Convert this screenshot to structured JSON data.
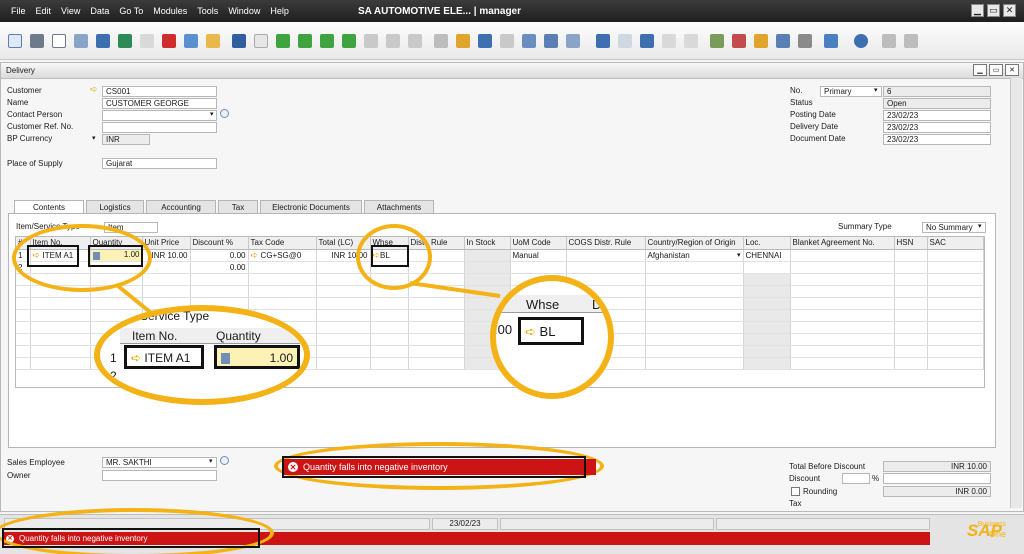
{
  "menu": [
    "File",
    "Edit",
    "View",
    "Data",
    "Go To",
    "Modules",
    "Tools",
    "Window",
    "Help"
  ],
  "app_title": "SA AUTOMOTIVE ELE... | manager",
  "window_buttons": [
    "▁",
    "▭",
    "✕"
  ],
  "doc": {
    "title": "Delivery",
    "header_left": {
      "customer_label": "Customer",
      "customer_value": "CS001",
      "name_label": "Name",
      "name_value": "CUSTOMER GEORGE",
      "contact_label": "Contact Person",
      "contact_value": "",
      "custref_label": "Customer Ref. No.",
      "custref_value": "",
      "currency_label": "BP Currency",
      "currency_value": "INR",
      "place_label": "Place of Supply",
      "place_value": "Gujarat"
    },
    "header_right": {
      "no_label": "No.",
      "series": "Primary",
      "no_value": "6",
      "status_label": "Status",
      "status_value": "Open",
      "posting_label": "Posting Date",
      "posting_value": "23/02/23",
      "delivery_label": "Delivery Date",
      "delivery_value": "23/02/23",
      "document_label": "Document Date",
      "document_value": "23/02/23"
    },
    "tabs": [
      "Contents",
      "Logistics",
      "Accounting",
      "Tax",
      "Electronic Documents",
      "Attachments"
    ],
    "item_type_label": "Item/Service Type",
    "item_type_value": "Item",
    "summary_label": "Summary Type",
    "summary_value": "No Summary",
    "columns": [
      "#",
      "Item No.",
      "Quantity",
      "Unit Price",
      "Discount %",
      "Tax Code",
      "Total (LC)",
      "Whse",
      "Distr. Rule",
      "In Stock",
      "UoM Code",
      "COGS Distr. Rule",
      "Country/Region of Origin",
      "Loc.",
      "Blanket Agreement No.",
      "HSN",
      "SAC"
    ],
    "rows": [
      {
        "n": "1",
        "item": "ITEM A1",
        "qty": "1.00",
        "price": "INR 10.00",
        "disc": "0.00",
        "tax": "CG+SG@0",
        "total": "INR 10.00",
        "whse": "BL",
        "distr": "",
        "stock": "",
        "uom": "Manual",
        "cogs": "",
        "country": "Afghanistan",
        "loc": "CHENNAI",
        "blanket": "",
        "hsn": "",
        "sac": ""
      },
      {
        "n": "2",
        "item": "",
        "qty": "",
        "price": "",
        "disc": "0.00",
        "tax": "",
        "total": "",
        "whse": "",
        "distr": "",
        "stock": "",
        "uom": "",
        "cogs": "",
        "country": "",
        "loc": "",
        "blanket": "",
        "hsn": "",
        "sac": ""
      }
    ],
    "zoom1": {
      "summary_fragment": "Service Type",
      "col_item": "Item No.",
      "col_qty": "Quantity",
      "row1_n": "1",
      "row1_item": "ITEM A1",
      "row1_qty": "1.00",
      "row2_n": "2",
      "edge": "1"
    },
    "zoom2": {
      "col_whse": "Whse",
      "col_next": "D",
      "qty_tail": ".00",
      "whse_value": "BL"
    },
    "footer_left": {
      "sales_emp_label": "Sales Employee",
      "sales_emp_value": "MR. SAKTHI",
      "owner_label": "Owner",
      "owner_value": ""
    },
    "footer_right": {
      "total_before_label": "Total Before Discount",
      "total_before_value": "INR 10.00",
      "discount_label": "Discount",
      "discount_pct": "%",
      "rounding_label": "Rounding",
      "rounding_value": "INR 0.00",
      "tax_label": "Tax"
    },
    "error_message": "Quantity falls into negative inventory"
  },
  "status_bar": {
    "date": "23/02/23",
    "message": "Quantity falls into negative inventory",
    "brand": "SAP",
    "brand_sub_1": "Business",
    "brand_sub_2": "One"
  },
  "colors": {
    "highlight": "#f3b215",
    "error": "#cc1414",
    "arrow": "#e9a600"
  }
}
